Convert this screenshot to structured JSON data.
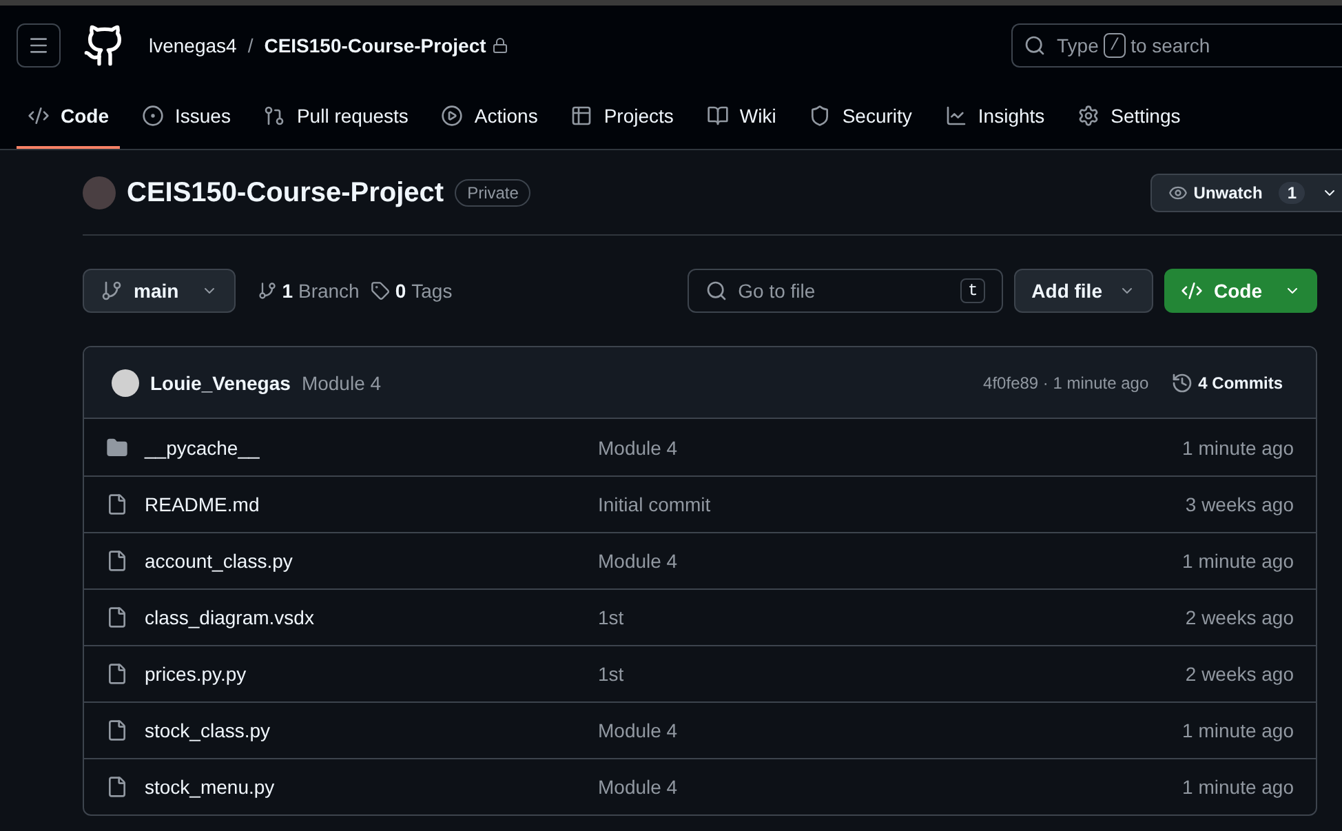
{
  "header": {
    "owner": "lvenegas4",
    "separator": "/",
    "repo": "CEIS150-Course-Project",
    "search": {
      "before": "Type",
      "key": "/",
      "after": "to search"
    }
  },
  "tabs": [
    {
      "label": "Code",
      "kind": "code",
      "selected": true
    },
    {
      "label": "Issues",
      "kind": "issues",
      "selected": false
    },
    {
      "label": "Pull requests",
      "kind": "pulls",
      "selected": false
    },
    {
      "label": "Actions",
      "kind": "actions",
      "selected": false
    },
    {
      "label": "Projects",
      "kind": "projects",
      "selected": false
    },
    {
      "label": "Wiki",
      "kind": "wiki",
      "selected": false
    },
    {
      "label": "Security",
      "kind": "security",
      "selected": false
    },
    {
      "label": "Insights",
      "kind": "insights",
      "selected": false
    },
    {
      "label": "Settings",
      "kind": "settings",
      "selected": false
    }
  ],
  "repo": {
    "title": "CEIS150-Course-Project",
    "visibility": "Private",
    "watch": {
      "label": "Unwatch",
      "count": "1"
    }
  },
  "toolbar": {
    "branch": "main",
    "branches": {
      "count": "1",
      "label": "Branch"
    },
    "tags": {
      "count": "0",
      "label": "Tags"
    },
    "go_to_file": {
      "placeholder": "Go to file",
      "key": "t"
    },
    "add_file": "Add file",
    "code": "Code"
  },
  "commit": {
    "author": "Louie_Venegas",
    "message": "Module 4",
    "hash": "4f0fe89 · 1 minute ago",
    "commits": "4 Commits"
  },
  "files": [
    {
      "kind": "folder",
      "name": "__pycache__",
      "message": "Module 4",
      "time": "1 minute ago"
    },
    {
      "kind": "file",
      "name": "README.md",
      "message": "Initial commit",
      "time": "3 weeks ago"
    },
    {
      "kind": "file",
      "name": "account_class.py",
      "message": "Module 4",
      "time": "1 minute ago"
    },
    {
      "kind": "file",
      "name": "class_diagram.vsdx",
      "message": "1st",
      "time": "2 weeks ago"
    },
    {
      "kind": "file",
      "name": "prices.py.py",
      "message": "1st",
      "time": "2 weeks ago"
    },
    {
      "kind": "file",
      "name": "stock_class.py",
      "message": "Module 4",
      "time": "1 minute ago"
    },
    {
      "kind": "file",
      "name": "stock_menu.py",
      "message": "Module 4",
      "time": "1 minute ago"
    }
  ]
}
